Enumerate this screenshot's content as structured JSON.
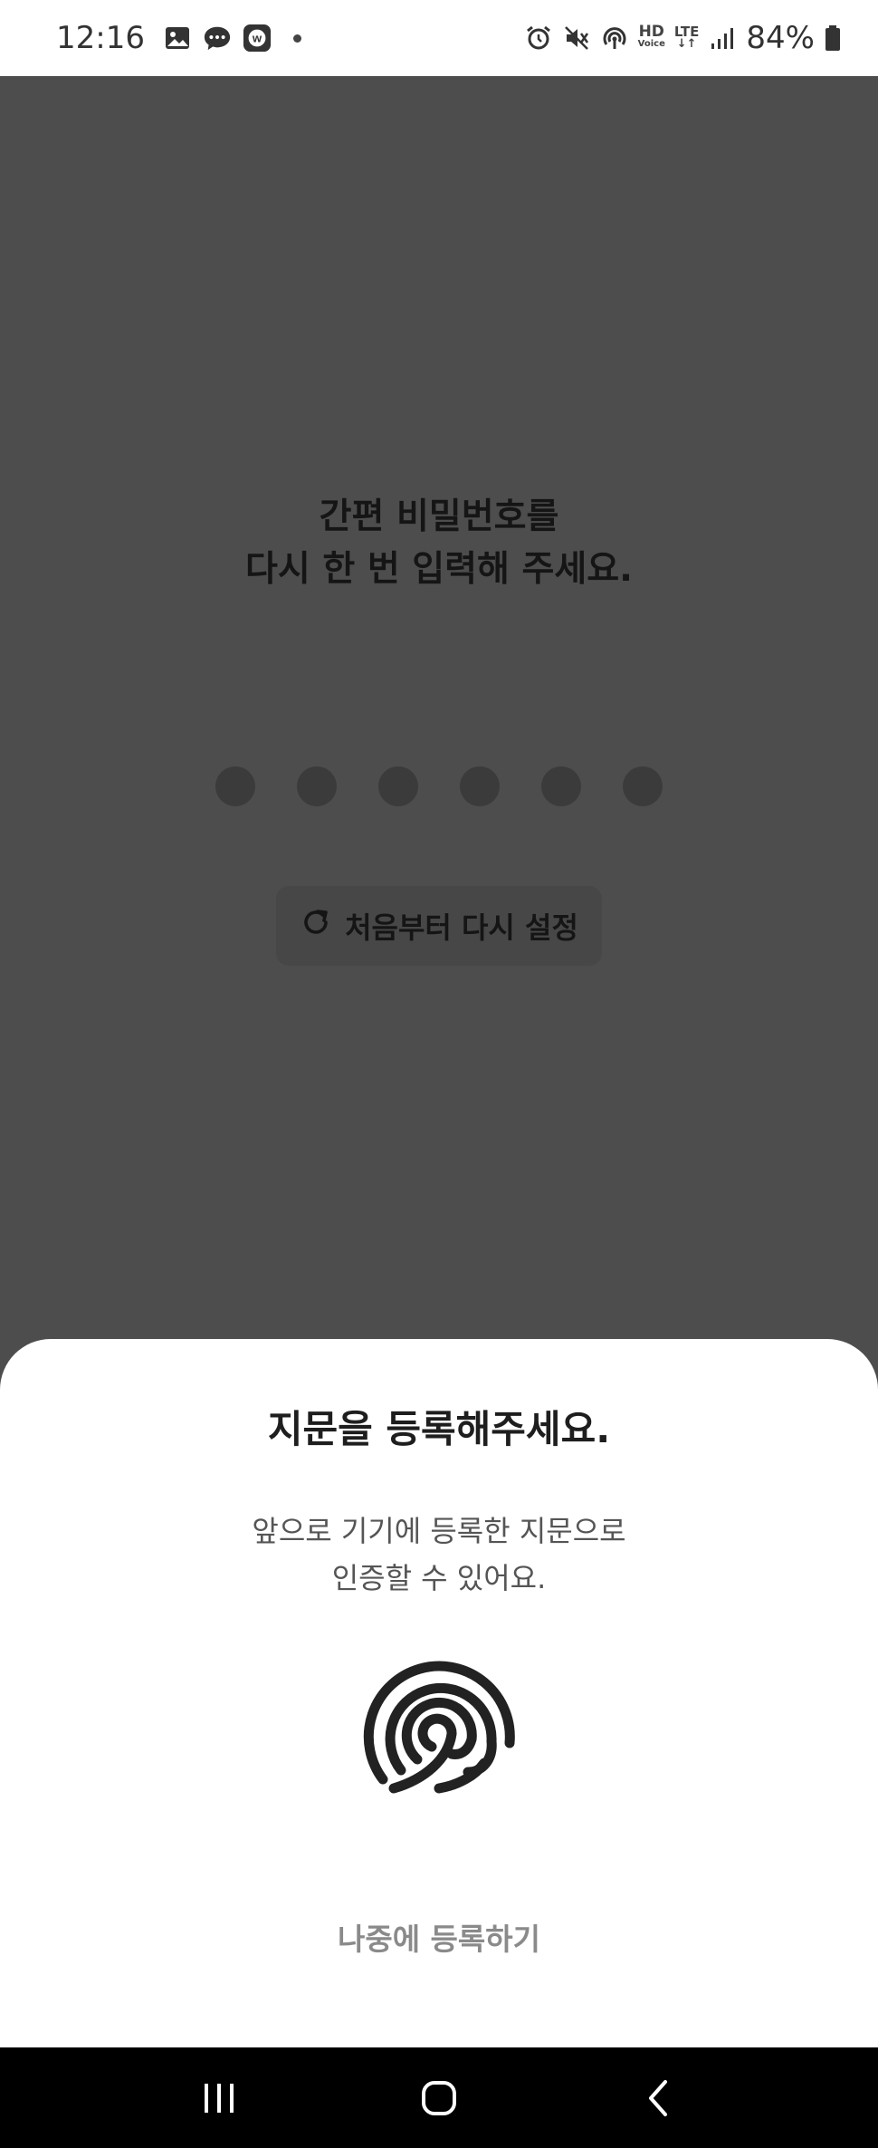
{
  "status_bar": {
    "time": "12:16",
    "hd_label_top": "HD",
    "hd_label_bottom": "Voice",
    "lte_label": "LTE",
    "battery_percent": "84%",
    "notification_icons": [
      "gallery-icon",
      "messages-icon",
      "w-app-icon"
    ],
    "system_icons": [
      "alarm-icon",
      "mute-icon",
      "hotspot-icon",
      "hd-voice-icon",
      "lte-icon",
      "signal-icon",
      "battery-icon"
    ]
  },
  "pin_screen": {
    "title_line1": "간편 비밀번호를",
    "title_line2": "다시 한 번 입력해 주세요.",
    "pin_length": 6,
    "reset_label": "처음부터 다시 설정"
  },
  "fingerprint_sheet": {
    "title": "지문을 등록해주세요.",
    "desc_line1": "앞으로 기기에 등록한 지문으로",
    "desc_line2": "인증할 수 있어요.",
    "later_label": "나중에 등록하기"
  },
  "nav_bar": {
    "buttons": [
      "recents-icon",
      "home-icon",
      "back-icon"
    ]
  },
  "colors": {
    "overlay": "#4d4d4d",
    "sheet_bg": "#ffffff",
    "nav_bg": "#000000",
    "text_dark": "#1e1e1e",
    "text_muted": "#8a8a8a"
  }
}
